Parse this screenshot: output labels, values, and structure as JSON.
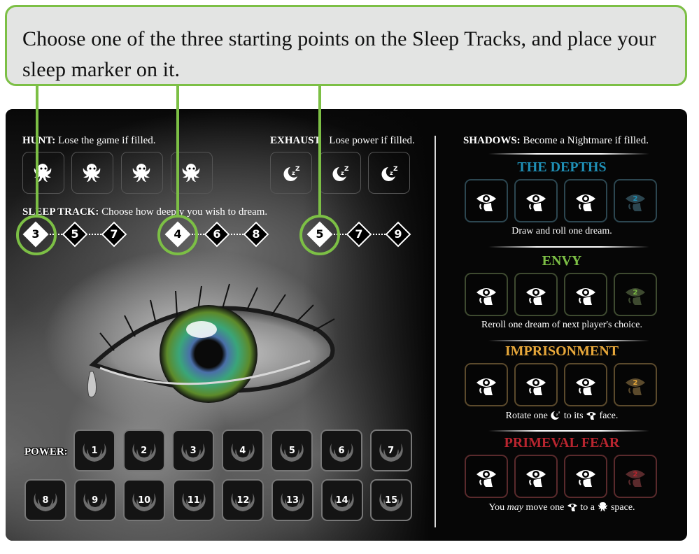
{
  "callout": {
    "text": "Choose one of the three starting points on the Sleep Tracks, and place your sleep marker on it.",
    "accent_color": "#7cbf45"
  },
  "hunt": {
    "title": "HUNT:",
    "description": "Lose the game if filled.",
    "slots": [
      {
        "icon": "tentacle-monster-icon"
      },
      {
        "icon": "tentacle-monster-icon"
      },
      {
        "icon": "tentacle-monster-icon"
      },
      {
        "icon": "tentacle-monster-icon"
      }
    ]
  },
  "exhaust": {
    "title": "EXHAUST",
    "description": "Lose power if filled.",
    "slots": [
      {
        "icon": "moon-sleep-icon"
      },
      {
        "icon": "moon-sleep-icon"
      },
      {
        "icon": "moon-sleep-icon"
      }
    ]
  },
  "sleep_track": {
    "title": "SLEEP TRACK:",
    "description": "Choose how deeply you wish to dream.",
    "tracks": [
      {
        "start": "3",
        "steps": [
          "5",
          "7"
        ]
      },
      {
        "start": "4",
        "steps": [
          "6",
          "8"
        ]
      },
      {
        "start": "5",
        "steps": [
          "7",
          "9"
        ]
      }
    ]
  },
  "power": {
    "label": "POWER:",
    "slots": [
      "1",
      "2",
      "3",
      "4",
      "5",
      "6",
      "7",
      "8",
      "9",
      "10",
      "11",
      "12",
      "13",
      "14",
      "15"
    ]
  },
  "shadows": {
    "title": "SHADOWS:",
    "description": "Become a Nightmare if filled.",
    "sections": [
      {
        "name": "THE DEPTHS",
        "color": "#1f8fb5",
        "border": "#2c4650",
        "final_value": "2",
        "effect": [
          "Draw and roll one dream."
        ]
      },
      {
        "name": "ENVY",
        "color": "#7cbf45",
        "border": "#3e4a30",
        "final_value": "2",
        "effect": [
          "Reroll one dream of next player's choice."
        ]
      },
      {
        "name": "IMPRISONMENT",
        "color": "#e8a83a",
        "border": "#5b4a2c",
        "final_value": "2",
        "effect": [
          "Rotate one",
          "to its",
          "face."
        ]
      },
      {
        "name": "PRIMEVAL FEAR",
        "color": "#b8252f",
        "border": "#5a2a2c",
        "final_value": "2",
        "effect": [
          "You",
          "may",
          "move one",
          "to a",
          "space."
        ]
      }
    ]
  }
}
